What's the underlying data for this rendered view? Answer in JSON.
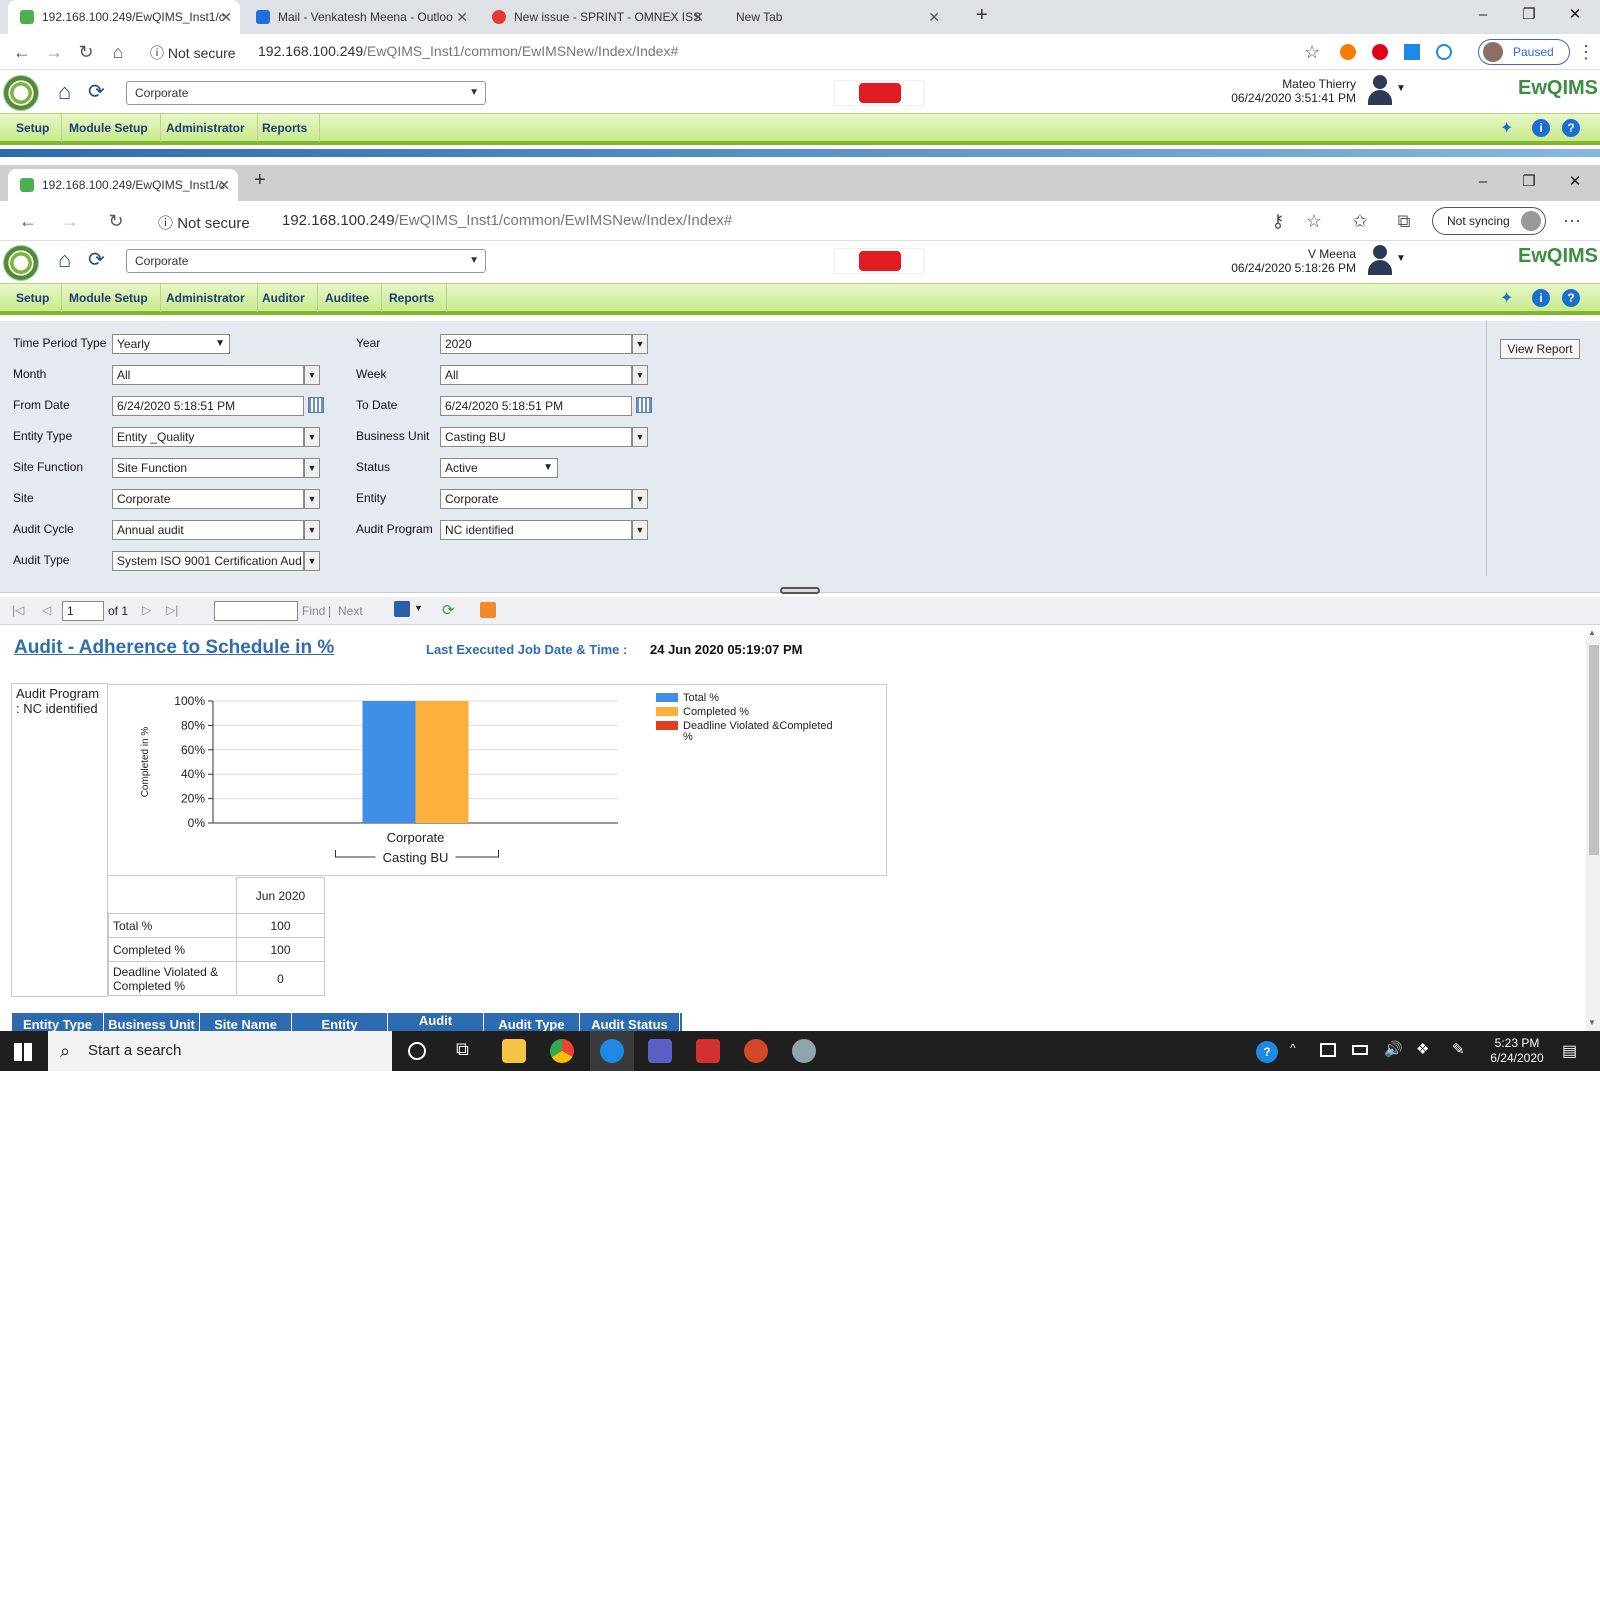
{
  "outer_chrome": {
    "tabs": [
      {
        "label": "192.168.100.249/EwQIMS_Inst1/c",
        "color": "#4caf50"
      },
      {
        "label": "Mail - Venkatesh Meena - Outloo",
        "color": "#1e6fd9"
      },
      {
        "label": "New issue - SPRINT - OMNEX ISS",
        "color": "#e53935"
      },
      {
        "label": "New Tab",
        "color": ""
      }
    ],
    "not_secure": "Not secure",
    "url_host": "192.168.100.249",
    "url_path": "/EwQIMS_Inst1/common/EwIMSNew/Index/Index#",
    "profile_label": "Paused"
  },
  "inner_chrome": {
    "tab_label": "192.168.100.249/EwQIMS_Inst1/c",
    "not_secure": "Not secure",
    "url_host": "192.168.100.249",
    "url_path": "/EwQIMS_Inst1/common/EwIMSNew/Index/Index#",
    "sync_label": "Not syncing"
  },
  "app1": {
    "site_select": "Corporate",
    "user_name": "Mateo Thierry",
    "user_time": "06/24/2020 3:51:41 PM",
    "brand": "EwQIMS",
    "menu": [
      "Setup",
      "Module Setup",
      "Administrator",
      "Reports"
    ]
  },
  "app2": {
    "site_select": "Corporate",
    "user_name": "V Meena",
    "user_time": "06/24/2020 5:18:26 PM",
    "brand": "EwQIMS",
    "menu": [
      "Setup",
      "Module Setup",
      "Administrator",
      "Auditor",
      "Auditee",
      "Reports"
    ]
  },
  "form": {
    "left": [
      {
        "label": "Time Period Type",
        "value": "Yearly"
      },
      {
        "label": "Month",
        "value": "All"
      },
      {
        "label": "From Date",
        "value": "6/24/2020 5:18:51 PM"
      },
      {
        "label": "Entity Type",
        "value": "Entity _Quality"
      },
      {
        "label": "Site Function",
        "value": "Site Function"
      },
      {
        "label": "Site",
        "value": "Corporate"
      },
      {
        "label": "Audit Cycle",
        "value": "Annual audit"
      },
      {
        "label": "Audit Type",
        "value": "System ISO 9001 Certification Aud"
      }
    ],
    "right": [
      {
        "label": "Year",
        "value": "2020"
      },
      {
        "label": "Week",
        "value": "All"
      },
      {
        "label": "To Date",
        "value": "6/24/2020 5:18:51 PM"
      },
      {
        "label": "Business Unit",
        "value": "Casting BU"
      },
      {
        "label": "Status",
        "value": "Active"
      },
      {
        "label": "Entity",
        "value": "Corporate"
      },
      {
        "label": "Audit Program",
        "value": "NC identified"
      }
    ],
    "view_report": "View Report"
  },
  "toolbar": {
    "page": "1",
    "of": "of 1",
    "find": "Find",
    "sep": "|",
    "next": "Next"
  },
  "report": {
    "title": "Audit - Adherence to Schedule in %",
    "last_exec_label": "Last Executed Job Date & Time :",
    "last_exec_value": "24 Jun 2020 05:19:07 PM",
    "group_label": "Audit Program : NC identified",
    "table": {
      "column": "Jun 2020",
      "rows": [
        {
          "label": "Total %",
          "value": "100"
        },
        {
          "label": "Completed %",
          "value": "100"
        },
        {
          "label": "Deadline Violated & Completed %",
          "value": "0"
        }
      ]
    },
    "grid_headers": [
      "Entity Type",
      "Business Unit",
      "Site Name",
      "Entity",
      "Audit",
      "Audit Type",
      "Audit Status"
    ]
  },
  "chart_data": {
    "type": "bar",
    "categories": [
      "Corporate"
    ],
    "group_label": "Casting BU",
    "ylabel": "Completed in %",
    "ylim": [
      0,
      100
    ],
    "yticks": [
      "0%",
      "20%",
      "40%",
      "60%",
      "80%",
      "100%"
    ],
    "series": [
      {
        "name": "Total %",
        "values": [
          100
        ],
        "color": "#3f8fe8"
      },
      {
        "name": "Completed %",
        "values": [
          100
        ],
        "color": "#fbb03b"
      },
      {
        "name": "Deadline Violated &Completed %",
        "values": [
          0
        ],
        "color": "#e0401c"
      }
    ],
    "legend": "right"
  },
  "taskbar": {
    "search": "Start a search",
    "time": "5:23 PM",
    "date": "6/24/2020"
  }
}
